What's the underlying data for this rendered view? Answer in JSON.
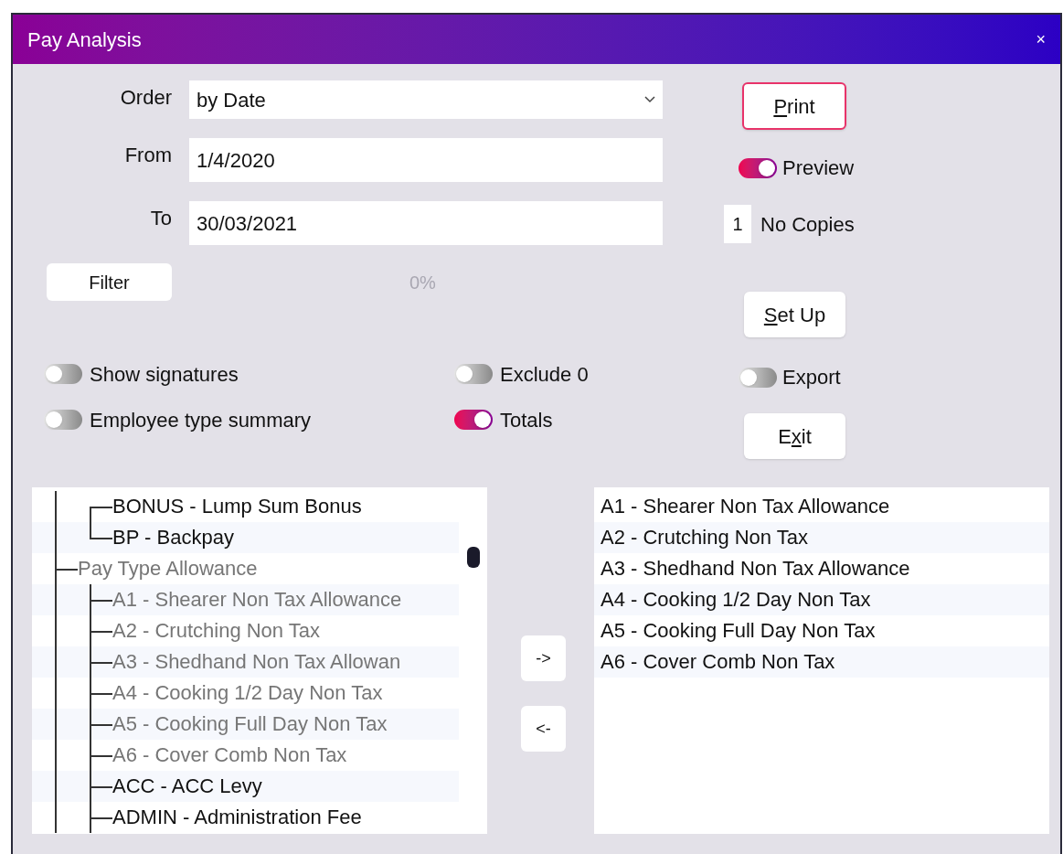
{
  "window": {
    "title": "Pay Analysis",
    "close": "×"
  },
  "fields": [
    {
      "label": "Order",
      "value": "by Date",
      "kind": "dropdown"
    },
    {
      "label": "From",
      "value": "1/4/2020",
      "kind": "text"
    },
    {
      "label": "To",
      "value": "30/03/2021",
      "kind": "text"
    }
  ],
  "filter_button": "Filter",
  "progress_text": "0%",
  "options": [
    {
      "label": "Show signatures",
      "on": false
    },
    {
      "label": "Exclude 0",
      "on": false
    },
    {
      "label": "Employee type summary",
      "on": false
    },
    {
      "label": "Totals",
      "on": true
    }
  ],
  "print_button": {
    "key": "P",
    "after": "rint"
  },
  "preview": {
    "label": "Preview",
    "on": true
  },
  "copies": {
    "value": "1",
    "label": "No Copies"
  },
  "setup_button": {
    "key": "S",
    "after": "et Up"
  },
  "export": {
    "label": "Export",
    "on": false
  },
  "exit_button": {
    "before": "E",
    "key": "x",
    "after": "it"
  },
  "pay_type_tree": [
    {
      "children": [
        {
          "label": "BONUS - Lump Sum Bonus",
          "greyed": false
        },
        {
          "label": "BP - Backpay",
          "greyed": false
        }
      ]
    },
    {
      "label": "Pay Type Allowance",
      "greyed": true,
      "children": [
        {
          "label": "A1 - Shearer Non Tax Allowance",
          "greyed": true
        },
        {
          "label": "A2 - Crutching Non Tax",
          "greyed": true
        },
        {
          "label": "A3 - Shedhand Non Tax Allowan",
          "greyed": true
        },
        {
          "label": "A4 - Cooking 1/2 Day Non Tax",
          "greyed": true
        },
        {
          "label": "A5 - Cooking Full Day Non Tax",
          "greyed": true
        },
        {
          "label": "A6 - Cover Comb Non Tax",
          "greyed": true
        },
        {
          "label": "ACC - ACC Levy",
          "greyed": false
        },
        {
          "label": "ADMIN - Administration Fee",
          "greyed": false
        }
      ]
    }
  ],
  "add_button": "->",
  "remove_button": "<-",
  "selected_pay_types": [
    "A1 - Shearer Non Tax Allowance",
    "A2 - Crutching Non Tax",
    "A3 - Shedhand Non Tax Allowance",
    "A4 - Cooking 1/2 Day Non Tax",
    "A5 - Cooking Full Day Non Tax",
    "A6 - Cover Comb Non Tax"
  ]
}
